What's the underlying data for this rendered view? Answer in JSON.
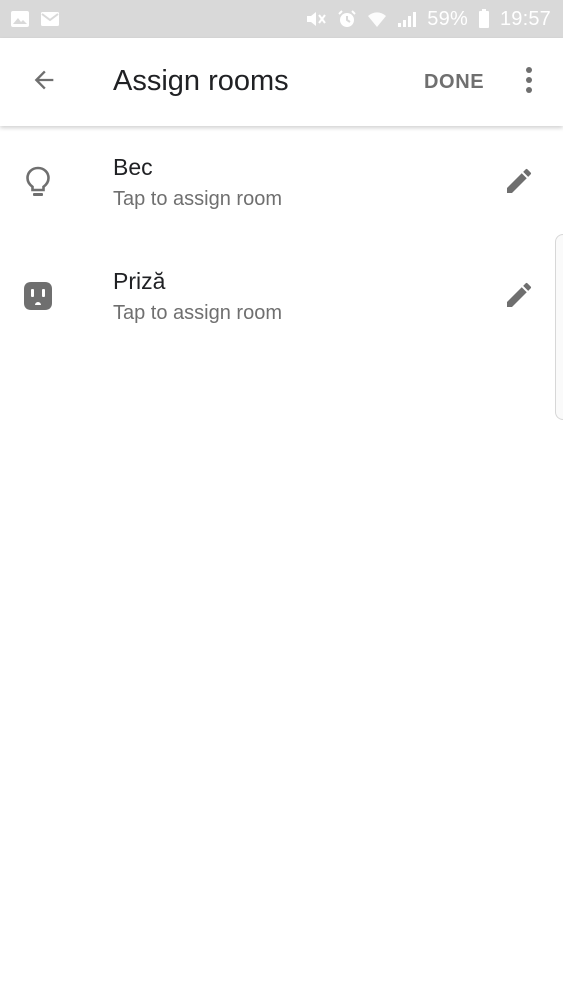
{
  "status_bar": {
    "battery_percent": "59%",
    "time": "19:57",
    "icons": [
      "image-notification-icon",
      "gmail-notification-icon",
      "mute-icon",
      "alarm-icon",
      "wifi-icon",
      "signal-icon",
      "battery-icon"
    ]
  },
  "app_bar": {
    "title": "Assign rooms",
    "done_label": "DONE"
  },
  "devices": [
    {
      "name": "Bec",
      "subtitle": "Tap to assign room",
      "icon": "lightbulb-icon"
    },
    {
      "name": "Priză",
      "subtitle": "Tap to assign room",
      "icon": "outlet-icon"
    }
  ],
  "colors": {
    "status_bar_bg": "#d9d9d9",
    "icon_gray": "#6f6f6f",
    "text_primary": "#202124"
  }
}
